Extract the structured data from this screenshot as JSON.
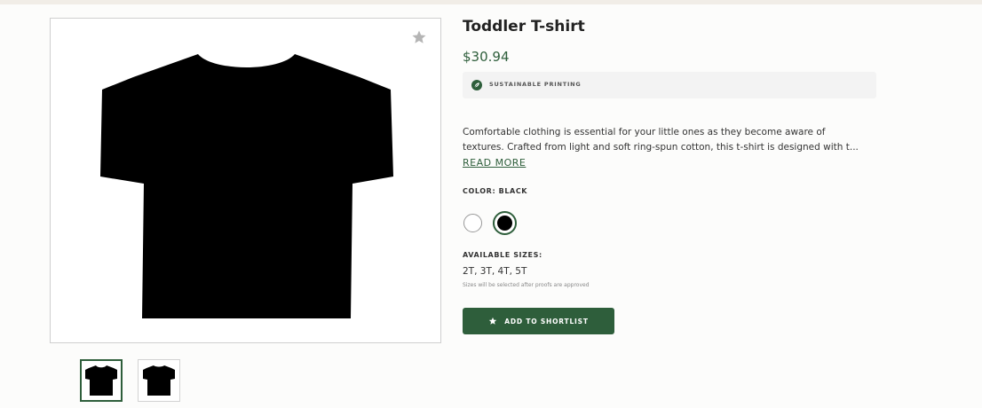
{
  "product": {
    "title": "Toddler T-shirt",
    "price": "$30.94",
    "badge": "SUSTAINABLE PRINTING",
    "description_line1": "Comfortable clothing is essential for your little ones as they become aware of",
    "description_line2": "textures. Crafted from light and soft ring-spun cotton, this t-shirt is designed with t...",
    "read_more": "READ MORE",
    "color_label": "COLOR: BLACK",
    "colors": [
      {
        "name": "white",
        "hex": "#ffffff",
        "selected": false
      },
      {
        "name": "black",
        "hex": "#000000",
        "selected": true
      }
    ],
    "sizes_label": "AVAILABLE SIZES:",
    "sizes": "2T, 3T, 4T, 5T",
    "sizes_note": "Sizes will be selected after proofs are approved",
    "shortlist_button": "ADD TO SHORTLIST"
  },
  "gallery": {
    "thumbnails": [
      {
        "name": "black-tee-front",
        "selected": true
      },
      {
        "name": "black-tee-back",
        "selected": false
      }
    ]
  },
  "icons": {
    "favorite": "star-icon",
    "badge": "leaf-icon",
    "button": "star-icon"
  },
  "colors": {
    "accent": "#2e5e3b",
    "badge_bg": "#f3f3f3",
    "page_bg": "#fcfcfb"
  }
}
